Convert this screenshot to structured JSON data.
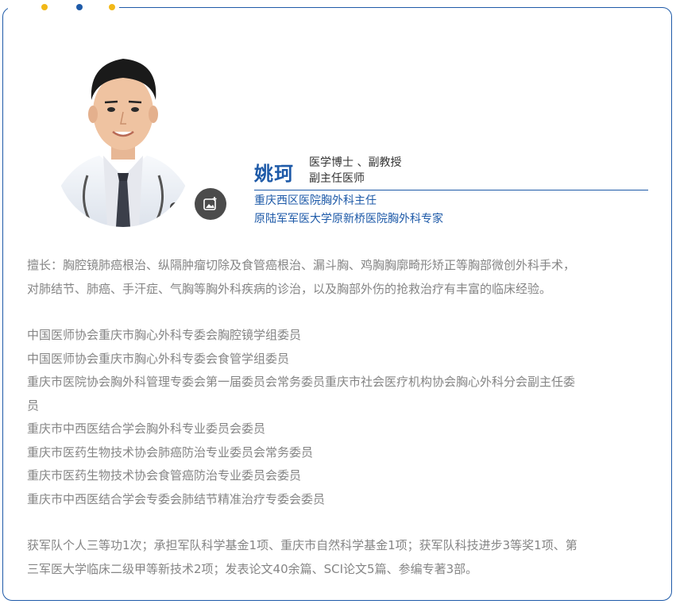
{
  "colors": {
    "brand_blue": "#1e5aa8",
    "accent_yellow": "#f2b817",
    "body_gray": "#858585"
  },
  "icons": {
    "photo_button": "add-photo-icon"
  },
  "profile": {
    "name": "姚珂",
    "titles": [
      "医学博士 、副教授",
      "副主任医师"
    ],
    "roles": [
      "重庆西区医院胸外科主任",
      "原陆军军医大学原新桥医院胸外科专家"
    ]
  },
  "specialty": {
    "line1": "擅长：胸腔镜肺癌根治、纵隔肿瘤切除及食管癌根治、漏斗胸、鸡胸胸廓畸形矫正等胸部微创外科手术，",
    "line2": "对肺结节、肺癌、手汗症、气胸等胸外科疾病的诊治，以及胸部外伤的抢救治疗有丰富的临床经验。"
  },
  "memberships": [
    "中国医师协会重庆市胸心外科专委会胸腔镜学组委员",
    "中国医师协会重庆市胸心外科专委会食管学组委员",
    "重庆市医院协会胸外科管理专委会第一届委员会常务委员重庆市社会医疗机构协会胸心外科分会副主任委",
    "员",
    "重庆市中西医结合学会胸外科专业委员会委员",
    "重庆市医药生物技术协会肺癌防治专业委员会常务委员",
    "重庆市医药生物技术协会食管癌防治专业委员会委员",
    "重庆市中西医结合学会专委会肺结节精准治疗专委会委员"
  ],
  "achievements": {
    "line1": "获军队个人三等功1次；承担军队科学基金1项、重庆市自然科学基金1项；获军队科技进步3等奖1项、第",
    "line2": "三军医大学临床二级甲等新技术2项；发表论文40余篇、SCI论文5篇、参编专著3部。"
  }
}
